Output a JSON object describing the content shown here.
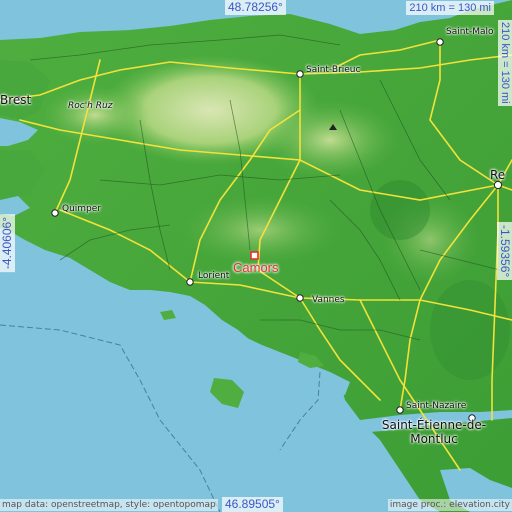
{
  "coordinates": {
    "north": "48.78256°",
    "south": "46.89505°",
    "west": "-4.40606°",
    "east": "-1.59356°"
  },
  "scale": {
    "horizontal": "210 km = 130 mi",
    "vertical": "210 km = 130 mi"
  },
  "focus_city": {
    "name": "Camors",
    "marker_color": "#e8322f"
  },
  "places": [
    {
      "id": "saint-malo",
      "name": "Saint-Malo"
    },
    {
      "id": "saint-brieuc",
      "name": "Saint-Brieuc"
    },
    {
      "id": "brest",
      "name": "Brest"
    },
    {
      "id": "roc-h-ruz",
      "name": "Roc'h Ruz"
    },
    {
      "id": "quimper",
      "name": "Quimper"
    },
    {
      "id": "lorient",
      "name": "Lorient"
    },
    {
      "id": "vannes",
      "name": "Vannes"
    },
    {
      "id": "rennes",
      "name": "Re"
    },
    {
      "id": "saint-nazaire",
      "name": "Saint-Nazaire"
    },
    {
      "id": "saint-etienne",
      "name": "Saint-Étienne-de-Montluc"
    }
  ],
  "credits": {
    "left": "map data: openstreetmap, style: opentopomap",
    "right": "image proc.: elevation.city"
  },
  "colors": {
    "sea": "#7fc3dd",
    "land_low": "#3aa63a",
    "land_mid": "#7cc45a",
    "land_high": "#c6dc9a",
    "roads": "#f2e23a",
    "coords_text": "#3b57c4"
  }
}
